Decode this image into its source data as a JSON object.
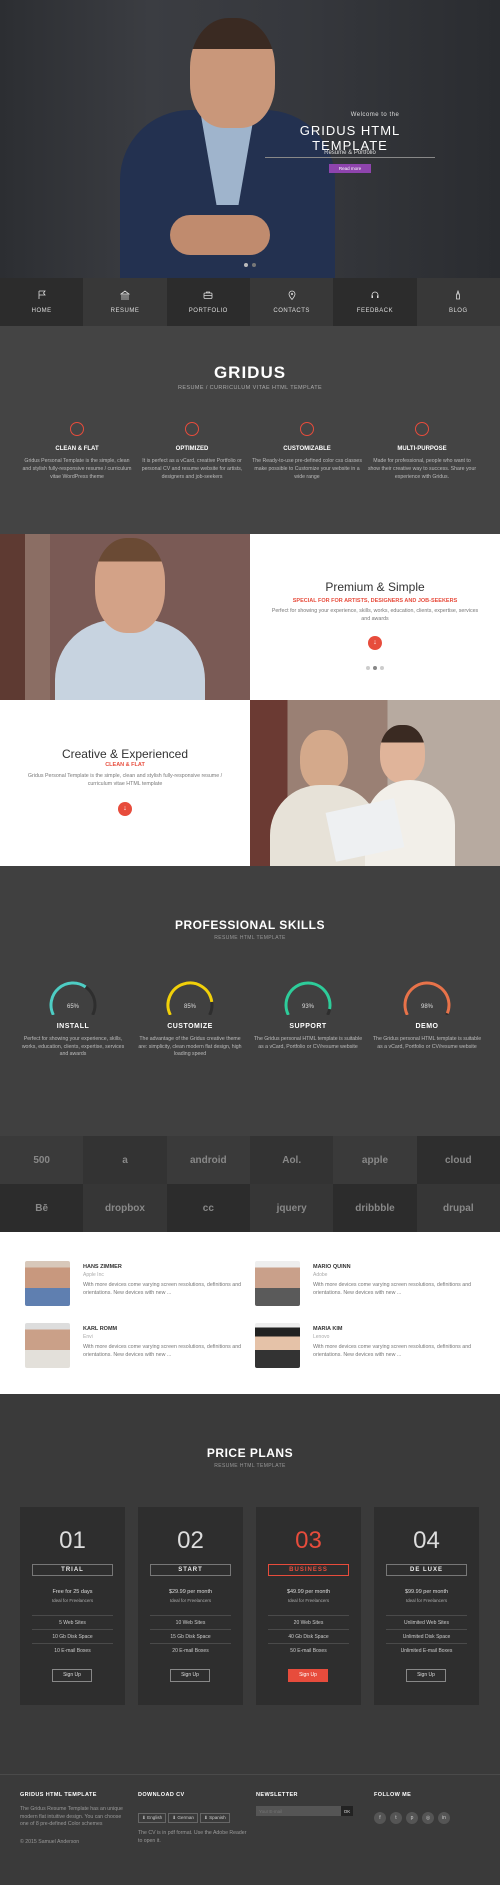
{
  "hero": {
    "welcome": "Welcome to the",
    "title": "GRIDUS HTML TEMPLATE",
    "subtitle": "Resume & Portfolio",
    "button": "Read more"
  },
  "nav": [
    {
      "label": "HOME",
      "icon": "flag-icon"
    },
    {
      "label": "RESUME",
      "icon": "bank-icon"
    },
    {
      "label": "PORTFOLIO",
      "icon": "briefcase-icon"
    },
    {
      "label": "CONTACTS",
      "icon": "map-pin-icon"
    },
    {
      "label": "FEEDBACK",
      "icon": "headset-icon"
    },
    {
      "label": "BLOG",
      "icon": "pen-icon"
    }
  ],
  "intro": {
    "title": "GRIDUS",
    "subtitle": "RESUME / CURRICULUM VITAE HTML TEMPLATE",
    "features": [
      {
        "title": "CLEAN & FLAT",
        "desc": "Gridus Personal Template is the simple, clean and stylish fully-responsive resume / curriculum vitae WordPress theme"
      },
      {
        "title": "OPTIMIZED",
        "desc": "It is perfect as a vCard, creative Portfolio or personal CV and resume website for artists, designers and job-seekers"
      },
      {
        "title": "CUSTOMIZABLE",
        "desc": "The Ready-to-use pre-defined color css classes make possible to Customize your website in a wide range"
      },
      {
        "title": "MULTI-PURPOSE",
        "desc": "Made for professional, people who want to show their creative way to success. Share your experience with Gridus."
      }
    ]
  },
  "premium": {
    "title": "Premium & Simple",
    "subtitle": "SPECIAL FOR FOR ARTISTS, DESIGNERS AND JOB-SEEKERS",
    "desc": "Perfect for showing your experience, skills, works, education, clients, expertise, services and awards"
  },
  "creative": {
    "title": "Creative & Experienced",
    "subtitle": "CLEAN & FLAT",
    "desc": "Gridus Personal Template is the simple, clean and stylish fully-responsive resume / curriculum vitae HTML template"
  },
  "skills": {
    "title": "PROFESSIONAL SKILLS",
    "subtitle": "RESUME HTML TEMPLATE",
    "items": [
      {
        "pct": "65%",
        "value": 65,
        "title": "INSTALL",
        "color": "#4ecdc4",
        "desc": "Perfect for showing your experience, skills, works, education, clients, expertise, services and awards"
      },
      {
        "pct": "85%",
        "value": 85,
        "title": "CUSTOMIZE",
        "color": "#f1d00a",
        "desc": "The advantage of the Gridus creative theme are: simplicity, clean modern flat design, high loading speed"
      },
      {
        "pct": "93%",
        "value": 93,
        "title": "SUPPORT",
        "color": "#2ecc9a",
        "desc": "The Gridus personal HTML template is suitable as a vCard, Portfolio or CV/resume website"
      },
      {
        "pct": "98%",
        "value": 98,
        "title": "DEMO",
        "color": "#e8734a",
        "desc": "The Gridus personal HTML template is suitable as a vCard, Portfolio or CV/resume website"
      }
    ]
  },
  "clients": [
    "500",
    "a",
    "android",
    "Aol.",
    "apple",
    "cloud",
    "Bē",
    "dropbox",
    "cc",
    "jquery",
    "dribbble",
    "drupal"
  ],
  "team": [
    {
      "name": "HANS ZIMMER",
      "company": "Apple Inc",
      "desc": "With more devices come varying screen resolutions, definitions and orientations. New devices with new ..."
    },
    {
      "name": "MARIO QUINN",
      "company": "Adobe",
      "desc": "With more devices come varying screen resolutions, definitions and orientations. New devices with new ..."
    },
    {
      "name": "KARL ROMM",
      "company": "Envi",
      "desc": "With more devices come varying screen resolutions, definitions and orientations. New devices with new ..."
    },
    {
      "name": "MARIA KIM",
      "company": "Lenovo",
      "desc": "With more devices come varying screen resolutions, definitions and orientations. New devices with new ..."
    }
  ],
  "pricing": {
    "title": "PRICE PLANS",
    "subtitle": "RESUME HTML TEMPLATE",
    "plans": [
      {
        "num": "01",
        "name": "TRIAL",
        "price": "Free for 25 days",
        "ideal": "Ideal for Freelancers",
        "rows": [
          "5 Web Sites",
          "10 Gb Disk Space",
          "10 E-mail Boxes"
        ],
        "button": "Sign Up"
      },
      {
        "num": "02",
        "name": "START",
        "price": "$29.99 per month",
        "ideal": "Ideal for Freelancers",
        "rows": [
          "10 Web Sites",
          "15 Gb Disk Space",
          "20 E-mail Boxes"
        ],
        "button": "Sign Up"
      },
      {
        "num": "03",
        "name": "BUSINESS",
        "price": "$49.99 per month",
        "ideal": "Ideal for Freelancers",
        "rows": [
          "20 Web Sites",
          "40 Gb Disk Space",
          "50 E-mail Boxes"
        ],
        "button": "Sign Up"
      },
      {
        "num": "04",
        "name": "DE LUXE",
        "price": "$99.99 per month",
        "ideal": "Ideal for Freelancers",
        "rows": [
          "Unlimited Web Sites",
          "Unlimited Disk Space",
          "Unlimited E-mail Boxes"
        ],
        "button": "Sign Up"
      }
    ]
  },
  "footer": {
    "col1_title": "GRIDUS HTML TEMPLATE",
    "col1_text": "The Gridus Resume Template has an unique modern flat intuitive design. You can choose one of 8 pre-defined Color schemes",
    "col2_title": "DOWNLOAD CV",
    "languages": [
      "English",
      "German",
      "Spanish"
    ],
    "col2_text": "The CV is in pdf format. Use the Adobe Reader to open it.",
    "col3_title": "NEWSLETTER",
    "email_placeholder": "Your E-mail",
    "ok": "OK",
    "col4_title": "FOLLOW ME",
    "social": [
      "facebook-icon",
      "twitter-icon",
      "pinterest-icon",
      "instagram-icon",
      "linkedin-icon"
    ],
    "copyright": "© 2015 Samuel Anderson"
  }
}
